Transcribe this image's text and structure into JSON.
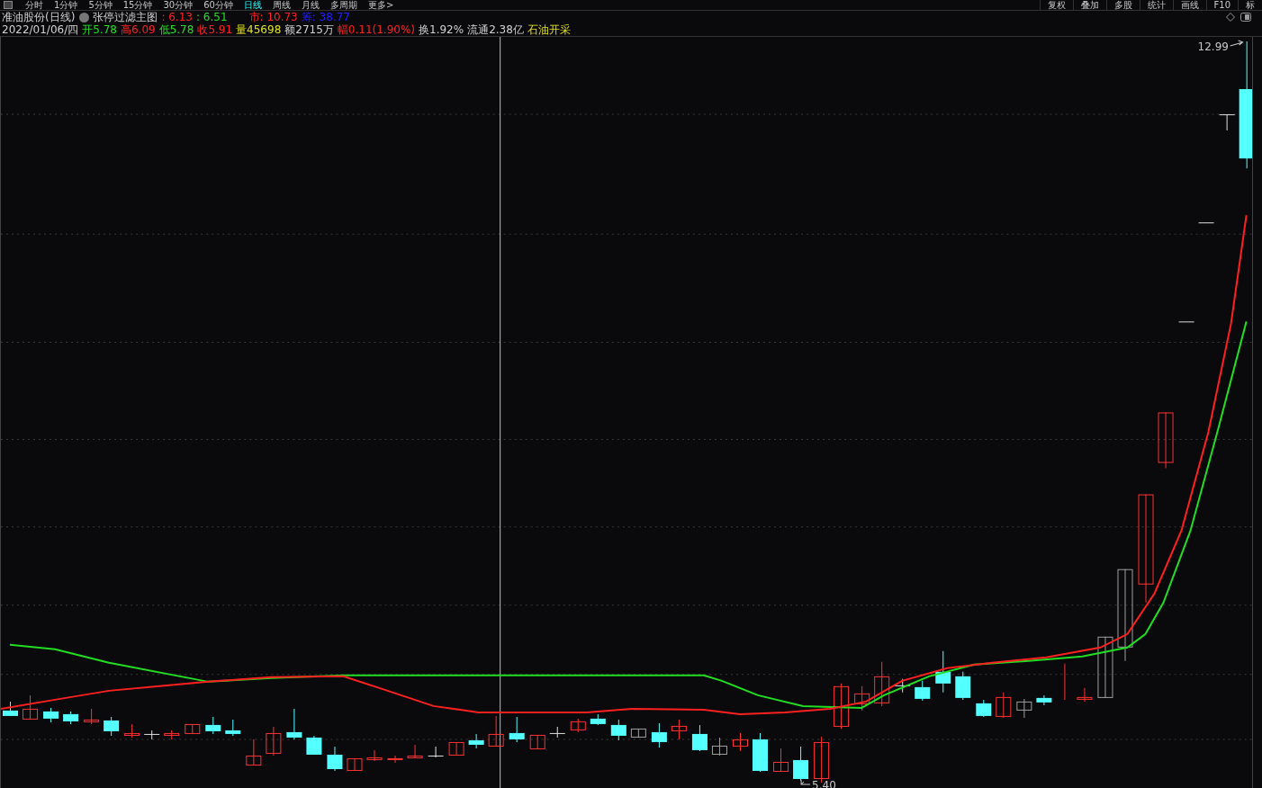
{
  "toolbar": {
    "tabs": [
      {
        "label": "分时",
        "selected": false
      },
      {
        "label": "1分钟",
        "selected": false
      },
      {
        "label": "5分钟",
        "selected": false
      },
      {
        "label": "15分钟",
        "selected": false
      },
      {
        "label": "30分钟",
        "selected": false
      },
      {
        "label": "60分钟",
        "selected": false
      },
      {
        "label": "日线",
        "selected": true
      },
      {
        "label": "周线",
        "selected": false
      },
      {
        "label": "月线",
        "selected": false
      },
      {
        "label": "多周期",
        "selected": false
      },
      {
        "label": "更多>",
        "selected": false
      }
    ],
    "buttons": [
      "复权",
      "叠加",
      "多股",
      "统计",
      "画线",
      "F10",
      "标"
    ]
  },
  "header": {
    "title": "准油股份(日线)",
    "indicator": "张停过滤主图",
    "values": [
      {
        "text": ": 6.13",
        "color": "#ff2020"
      },
      {
        "text": ": 6.51",
        "color": "#20e020"
      },
      {
        "text": "市: 10.73",
        "color": "#ff2020"
      },
      {
        "text": "筹: 38.77",
        "color": "#2020ff"
      }
    ]
  },
  "quote": {
    "date": "2022/01/06/四",
    "fields": [
      {
        "text": "开5.78",
        "color": "#20e020"
      },
      {
        "text": "高6.09",
        "color": "#ff2020"
      },
      {
        "text": "低5.78",
        "color": "#20e020"
      },
      {
        "text": "收5.91",
        "color": "#ff2020"
      },
      {
        "text": "量45698",
        "color": "#e0e020"
      },
      {
        "text": "额2715万",
        "color": "#d0d0d0"
      },
      {
        "text": "幅0.11(1.90%)",
        "color": "#ff2020"
      },
      {
        "text": "换1.92%",
        "color": "#d0d0d0"
      },
      {
        "text": "流通2.38亿",
        "color": "#d0d0d0"
      },
      {
        "text": "石油开采",
        "color": "#e0e020"
      }
    ]
  },
  "chart": {
    "high_label": "12.99",
    "low_label": "5.40"
  }
}
